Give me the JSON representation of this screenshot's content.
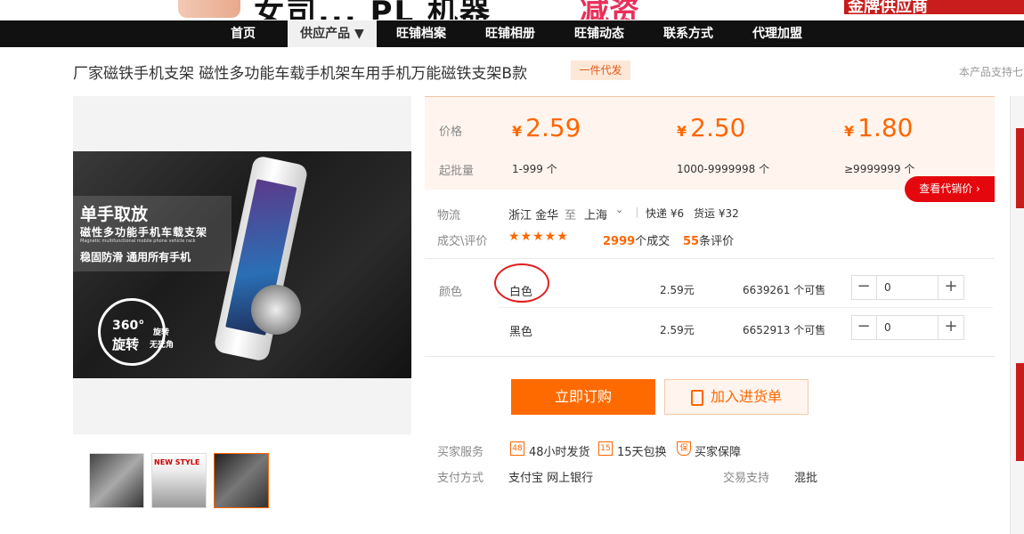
{
  "banner": {
    "text_left": "女司... PL 机器 ",
    "text_mid": "减资",
    "text_right": "金牌供应商"
  },
  "nav": {
    "items": [
      "首页",
      "供应产品 ▼",
      "旺铺档案",
      "旺铺相册",
      "旺铺动态",
      "联系方式",
      "代理加盟"
    ],
    "active_index": 1
  },
  "product": {
    "title": "厂家磁铁手机支架 磁性多功能车载手机架车用手机万能磁铁支架B款",
    "tag": "一件代发",
    "support_note": "本产品支持七"
  },
  "image": {
    "headline": "单手取放",
    "subhead": "磁性多功能手机车载支架",
    "english": "Magnetic multifunctional mobile phone vehicle rack",
    "feature": "稳固防滑  通用所有手机",
    "rotate_deg": "360°",
    "rotate_word": "旋转",
    "rotate_a": "旋转",
    "rotate_b": "无死角"
  },
  "thumbnails": [
    {
      "name": "thumb-1"
    },
    {
      "name": "thumb-2",
      "caption": "NEW STYLE"
    },
    {
      "name": "thumb-3",
      "selected": true
    }
  ],
  "pricing": {
    "price_label": "价格",
    "moq_label": "起批量",
    "currency": "¥",
    "tiers": [
      {
        "price": "2.59",
        "range": "1-999",
        "unit": "个"
      },
      {
        "price": "2.50",
        "range": "1000-9999998",
        "unit": "个"
      },
      {
        "price": "1.80",
        "range": "≥9999999",
        "unit": "个"
      }
    ],
    "see_price_button": "查看代销价 ›"
  },
  "logistics": {
    "label": "物流",
    "from": "浙江 金华",
    "to_word": "至",
    "to": "上海",
    "express": "快递 ¥6",
    "freight": "货运 ¥32"
  },
  "reviews": {
    "label": "成交\\评价",
    "stars": "★★★★★",
    "deals_count": "2999",
    "deals_suffix": "个成交",
    "review_count": "55",
    "review_suffix": "条评价"
  },
  "sku": {
    "label": "颜色",
    "options": [
      {
        "name": "白色",
        "price": "2.59元",
        "stock": "6639261 个可售",
        "qty": "0"
      },
      {
        "name": "黑色",
        "price": "2.59元",
        "stock": "6652913 个可售",
        "qty": "0"
      }
    ]
  },
  "actions": {
    "order_now": "立即订购",
    "add_to_cart": "加入进货单"
  },
  "services": {
    "label": "买家服务",
    "items": [
      {
        "icon": "48h-icon",
        "glyph": "48",
        "text": "48小时发货"
      },
      {
        "icon": "15day-icon",
        "glyph": "15",
        "text": "15天包换"
      },
      {
        "icon": "shield-icon",
        "glyph": "保",
        "text": "买家保障"
      }
    ]
  },
  "payment": {
    "label": "支付方式",
    "methods": "支付宝  网上银行",
    "trade_label": "交易支持",
    "trade_value": "混批"
  },
  "colors": {
    "accent": "#ff6600",
    "nav_bg": "#111111",
    "red": "#e4070d"
  }
}
